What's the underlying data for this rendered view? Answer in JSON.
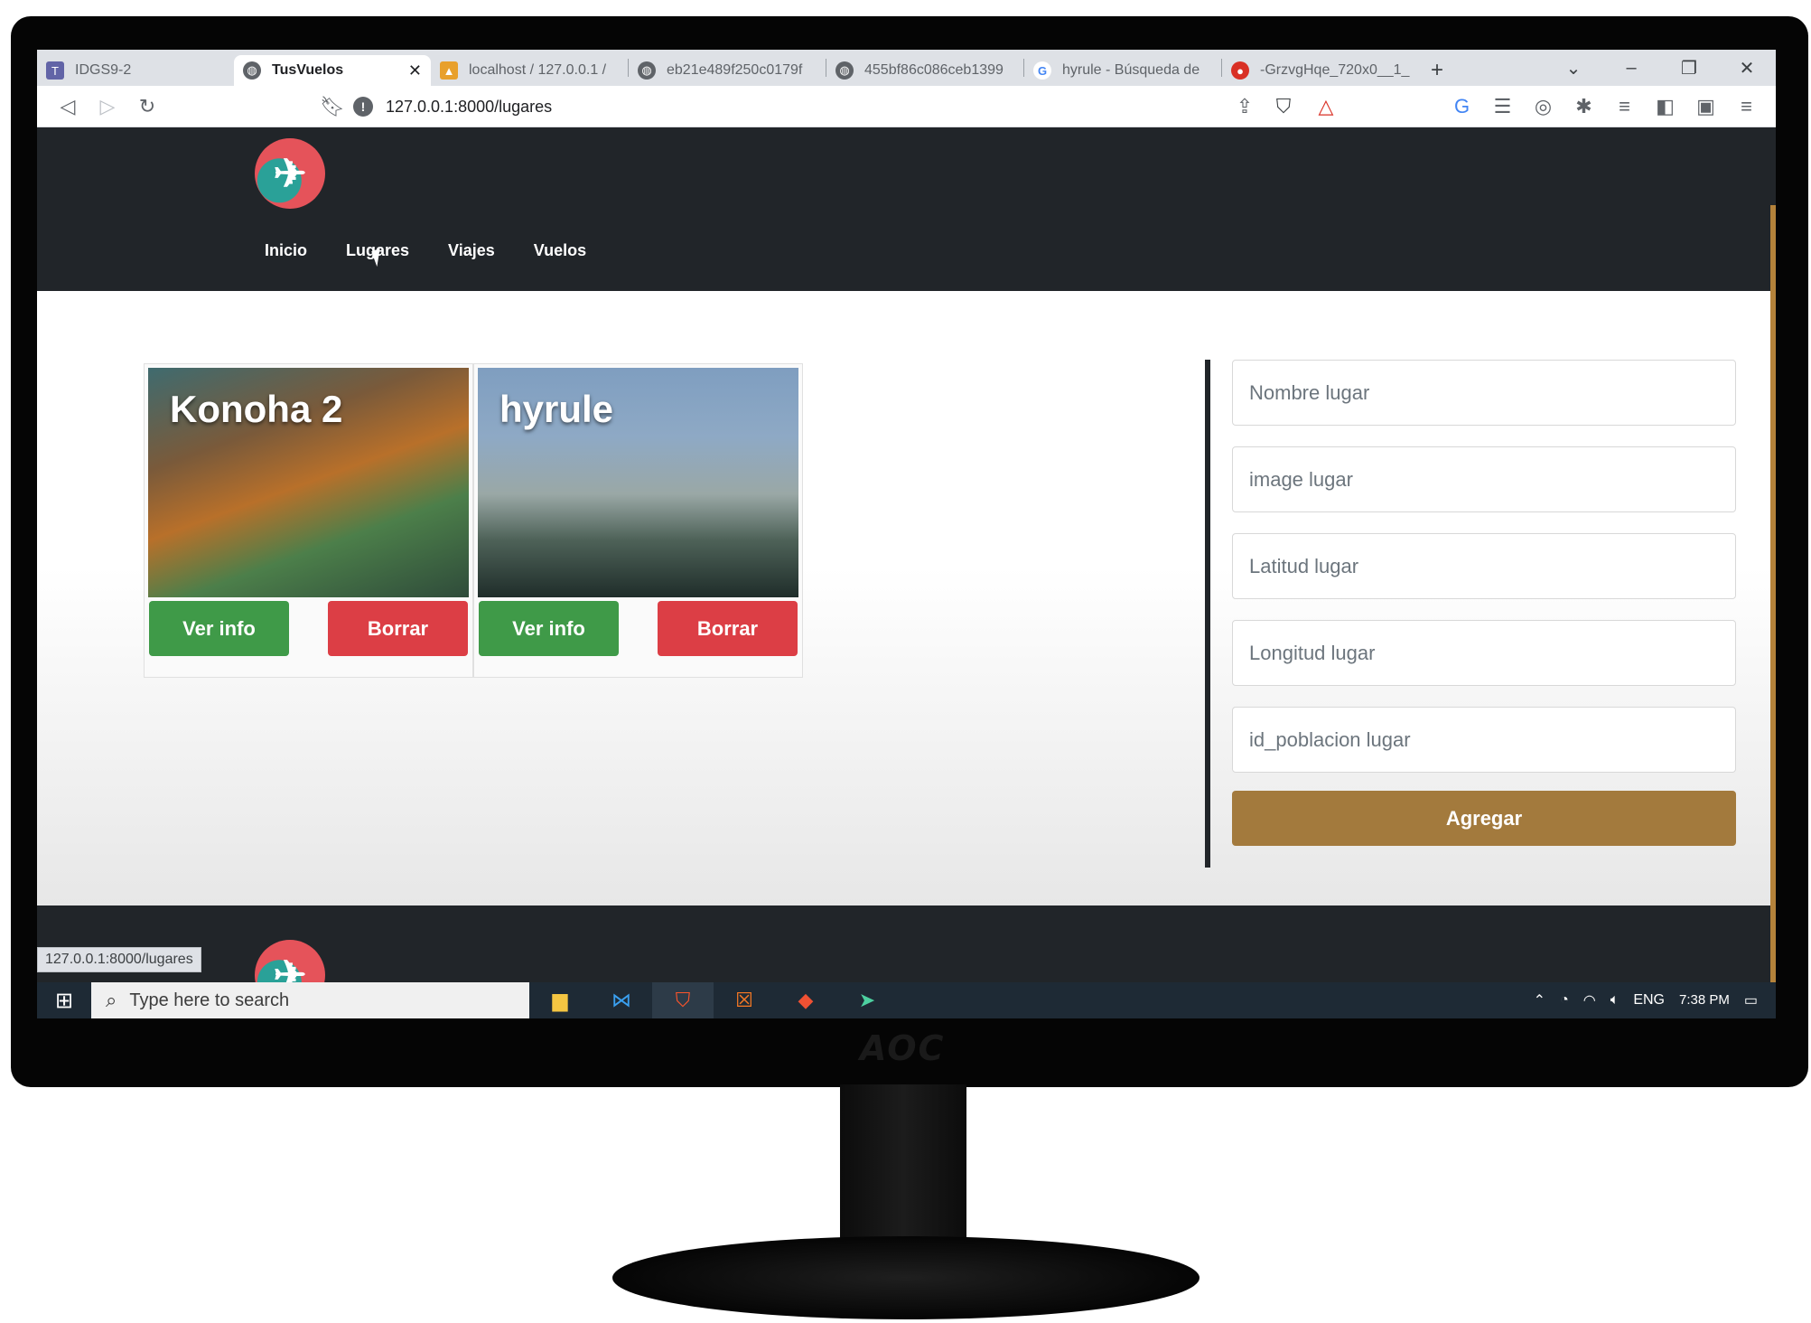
{
  "browser": {
    "tabs": [
      {
        "label": "IDGS9-2",
        "icon": "teams-icon",
        "color": "#6264a7"
      },
      {
        "label": "TusVuelos",
        "icon": "globe-icon",
        "color": "#5f6368",
        "active": true
      },
      {
        "label": "localhost / 127.0.0.1 /",
        "icon": "phpmyadmin-icon",
        "color": "#e8a02c"
      },
      {
        "label": "eb21e489f250c0179f",
        "icon": "globe-icon",
        "color": "#5f6368"
      },
      {
        "label": "455bf86c086ceb1399",
        "icon": "globe-icon",
        "color": "#5f6368"
      },
      {
        "label": "hyrule - Búsqueda de",
        "icon": "google-icon",
        "color": "#4285f4"
      },
      {
        "label": "-GrzvgHqe_720x0__1_",
        "icon": "image-icon",
        "color": "#d93025"
      }
    ],
    "url": "127.0.0.1:8000/lugares",
    "status_url": "127.0.0.1:8000/lugares"
  },
  "nav": {
    "links": [
      "Inicio",
      "Lugares",
      "Viajes",
      "Vuelos"
    ]
  },
  "lugares": [
    {
      "name": "Konoha 2",
      "info_label": "Ver info",
      "delete_label": "Borrar"
    },
    {
      "name": "hyrule",
      "info_label": "Ver info",
      "delete_label": "Borrar"
    }
  ],
  "form": {
    "placeholders": [
      "Nombre lugar",
      "image lugar",
      "Latitud lugar",
      "Longitud lugar",
      "id_poblacion lugar"
    ],
    "submit_label": "Agregar"
  },
  "taskbar": {
    "search_placeholder": "Type here to search",
    "language": "ENG",
    "time": "7:38 PM"
  },
  "monitor": {
    "brand": "AOC"
  },
  "colors": {
    "navbar": "#212529",
    "info_button": "#3f9a48",
    "delete_button": "#dc3e45",
    "submit_button": "#a37a3d"
  }
}
